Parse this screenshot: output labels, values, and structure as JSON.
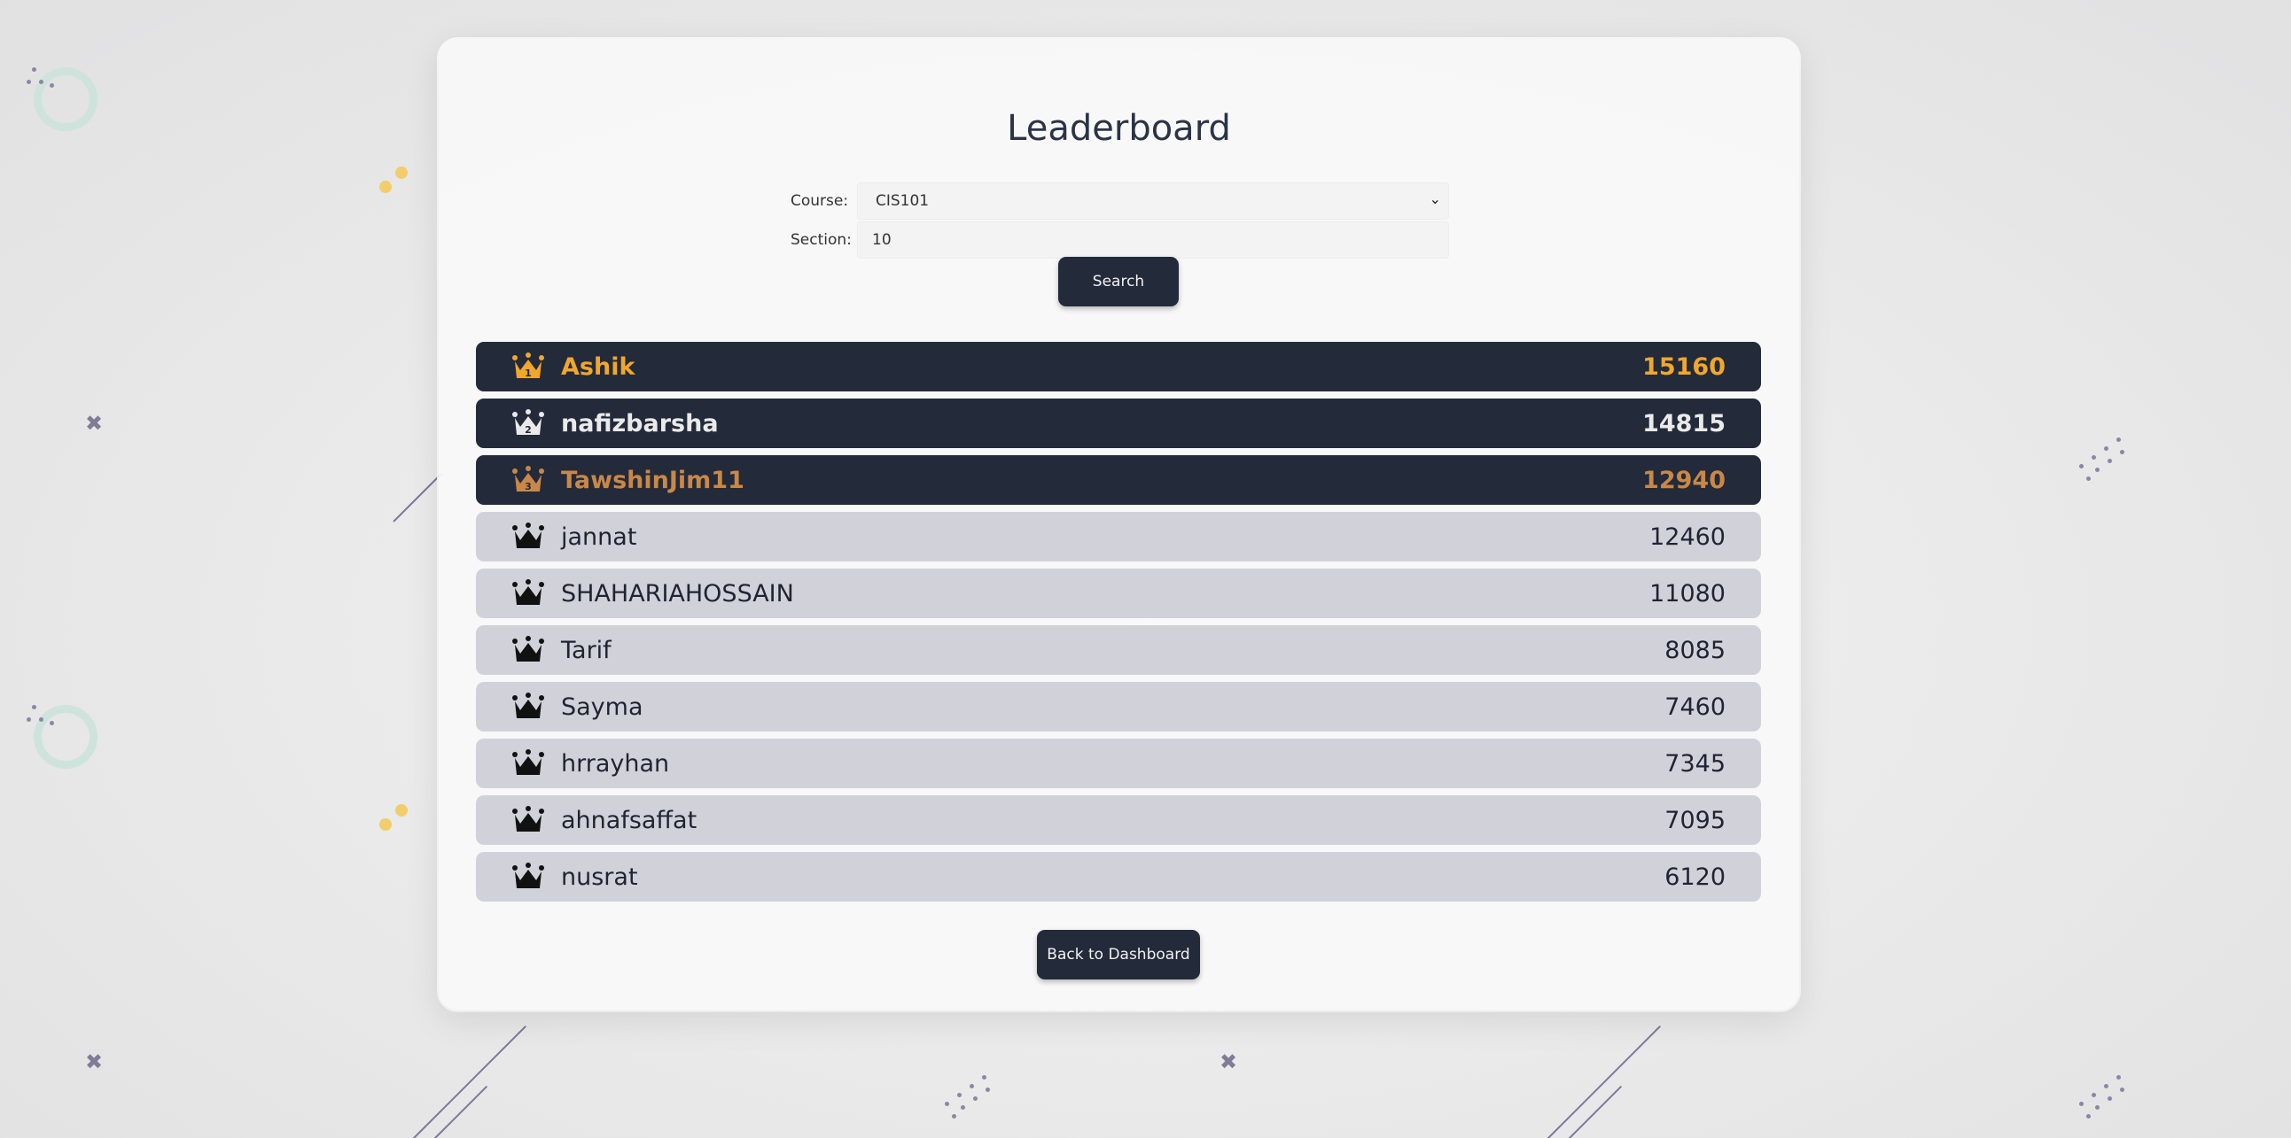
{
  "page": {
    "title": "Leaderboard"
  },
  "form": {
    "course_label": "Course:",
    "course_value": "CIS101",
    "section_label": "Section:",
    "section_value": "10",
    "search_label": "Search"
  },
  "leaderboard": [
    {
      "name": "Ashik",
      "score": "15160",
      "rank": "1",
      "color": "#f0a72c"
    },
    {
      "name": "nafizbarsha",
      "score": "14815",
      "rank": "2",
      "color": "#eaeaea"
    },
    {
      "name": "TawshinJim11",
      "score": "12940",
      "rank": "3",
      "color": "#c98848"
    },
    {
      "name": "jannat",
      "score": "12460"
    },
    {
      "name": "SHAHARIAHOSSAIN",
      "score": "11080"
    },
    {
      "name": "Tarif",
      "score": "8085"
    },
    {
      "name": "Sayma",
      "score": "7460"
    },
    {
      "name": "hrrayhan",
      "score": "7345"
    },
    {
      "name": "ahnafsaffat",
      "score": "7095"
    },
    {
      "name": "nusrat",
      "score": "6120"
    }
  ],
  "footer": {
    "back_label": "Back to Dashboard"
  },
  "icons": {
    "crown": "crown-icon"
  },
  "colors": {
    "dark_row": "#232a3a",
    "light_row": "#d1d2d9",
    "gold": "#f0a72c",
    "silver": "#d5d5d5",
    "bronze": "#c98848"
  }
}
